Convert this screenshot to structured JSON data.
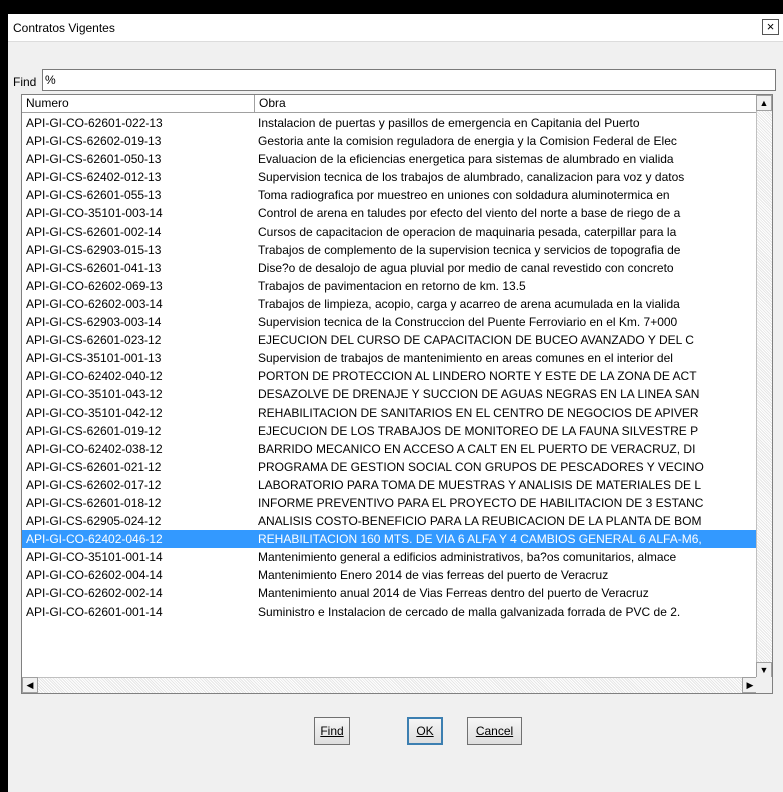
{
  "window": {
    "title": "Contratos Vigentes",
    "close_glyph": "×"
  },
  "find": {
    "label": "Find",
    "value": "%"
  },
  "table": {
    "columns": [
      "Numero",
      "Obra"
    ],
    "selected_index": 23,
    "rows": [
      [
        "API-GI-CO-62601-022-13",
        "Instalacion de puertas y pasillos de emergencia en Capitania del Puerto"
      ],
      [
        "API-GI-CS-62602-019-13",
        "Gestoria ante la comision reguladora de energia y la Comision Federal de Elec"
      ],
      [
        "API-GI-CS-62601-050-13",
        "Evaluacion de la eficiencias energetica para sistemas de alumbrado en vialida"
      ],
      [
        "API-GI-CS-62402-012-13",
        "Supervision tecnica de los trabajos de alumbrado, canalizacion para voz y datos"
      ],
      [
        "API-GI-CS-62601-055-13",
        "Toma radiografica por muestreo en uniones con soldadura aluminotermica en"
      ],
      [
        "API-GI-CO-35101-003-14",
        "Control de arena en taludes por efecto del viento del norte a base de riego de a"
      ],
      [
        "API-GI-CS-62601-002-14",
        "Cursos de capacitacion de operacion de maquinaria pesada, caterpillar para la"
      ],
      [
        "API-GI-CS-62903-015-13",
        "Trabajos de complemento de la supervision tecnica y servicios de topografia de"
      ],
      [
        "API-GI-CS-62601-041-13",
        "Dise?o de desalojo de agua pluvial por medio de canal revestido con concreto"
      ],
      [
        "API-GI-CO-62602-069-13",
        "Trabajos de pavimentacion en retorno de km. 13.5"
      ],
      [
        "API-GI-CO-62602-003-14",
        "Trabajos de limpieza, acopio, carga y acarreo de arena acumulada en la vialida"
      ],
      [
        "API-GI-CS-62903-003-14",
        "Supervision tecnica de la Construccion del Puente Ferroviario en el Km. 7+000"
      ],
      [
        "API-GI-CS-62601-023-12",
        "EJECUCION DEL CURSO DE CAPACITACION DE BUCEO AVANZADO Y DEL C"
      ],
      [
        "API-GI-CS-35101-001-13",
        "Supervision de trabajos de mantenimiento en areas comunes en el interior del"
      ],
      [
        "API-GI-CO-62402-040-12",
        "PORTON DE PROTECCION AL LINDERO NORTE Y ESTE DE LA ZONA DE ACT"
      ],
      [
        "API-GI-CO-35101-043-12",
        "DESAZOLVE DE DRENAJE Y SUCCION DE AGUAS NEGRAS EN LA LINEA SAN"
      ],
      [
        "API-GI-CO-35101-042-12",
        "REHABILITACION DE SANITARIOS EN EL CENTRO DE NEGOCIOS DE APIVER"
      ],
      [
        "API-GI-CS-62601-019-12",
        "EJECUCION DE LOS TRABAJOS DE MONITOREO DE LA FAUNA SILVESTRE P"
      ],
      [
        "API-GI-CO-62402-038-12",
        "BARRIDO MECANICO EN ACCESO A CALT EN EL PUERTO DE VERACRUZ, DI"
      ],
      [
        "API-GI-CS-62601-021-12",
        "PROGRAMA DE GESTION SOCIAL CON GRUPOS DE PESCADORES Y VECINO"
      ],
      [
        "API-GI-CS-62602-017-12",
        "LABORATORIO PARA TOMA DE MUESTRAS Y ANALISIS DE MATERIALES DE L"
      ],
      [
        "API-GI-CS-62601-018-12",
        "INFORME PREVENTIVO PARA EL PROYECTO DE HABILITACION DE 3 ESTANC"
      ],
      [
        "API-GI-CS-62905-024-12",
        "ANALISIS COSTO-BENEFICIO PARA LA REUBICACION DE LA PLANTA DE BOM"
      ],
      [
        "API-GI-CO-62402-046-12",
        "REHABILITACION 160 MTS. DE VIA 6 ALFA Y 4 CAMBIOS GENERAL 6 ALFA-M6,"
      ],
      [
        "API-GI-CO-35101-001-14",
        "Mantenimiento general a edificios administrativos, ba?os comunitarios, almace"
      ],
      [
        "API-GI-CO-62602-004-14",
        "Mantenimiento Enero 2014 de vias ferreas del puerto de Veracruz"
      ],
      [
        "API-GI-CO-62602-002-14",
        "Mantenimiento anual 2014 de Vias Ferreas dentro del puerto de Veracruz"
      ],
      [
        "API-GI-CO-62601-001-14",
        "Suministro e Instalacion de cercado de malla galvanizada forrada de PVC de 2."
      ]
    ]
  },
  "buttons": {
    "find": "Find",
    "ok": "OK",
    "cancel": "Cancel"
  },
  "icons": {
    "scroll_up": "▲",
    "scroll_down": "▼",
    "scroll_left": "◀",
    "scroll_right": "▶"
  },
  "colors": {
    "selection": "#3399ff",
    "selection_text": "#ffffff"
  }
}
